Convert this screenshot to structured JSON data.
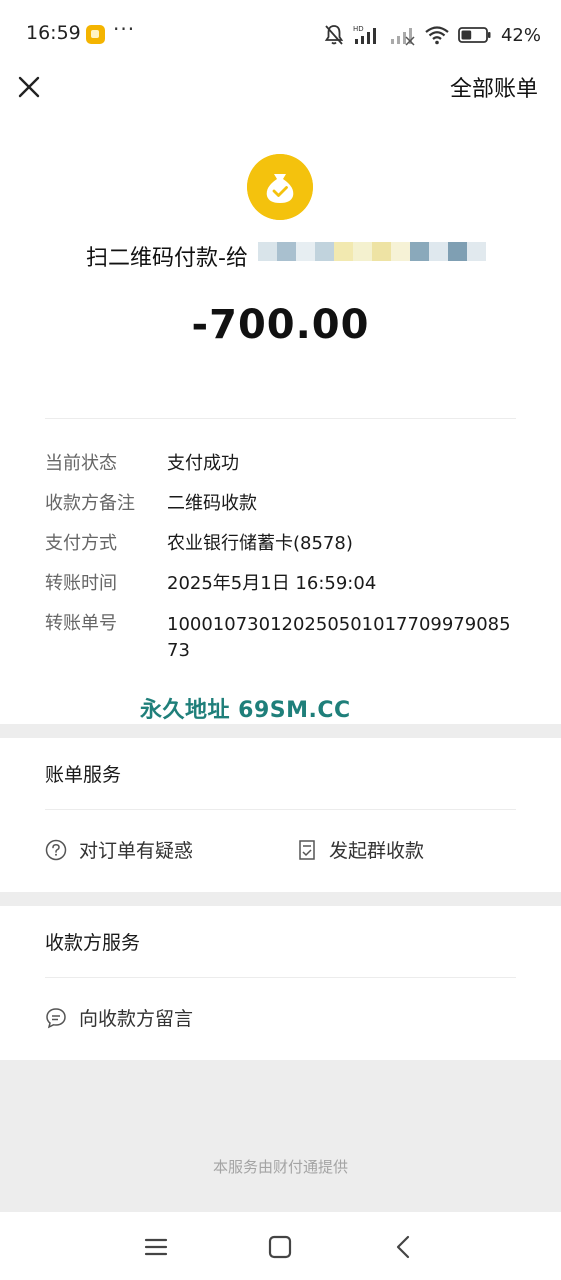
{
  "status_bar": {
    "time": "16:59",
    "app_icon": "notification-app-icon",
    "more": "···",
    "icons": [
      "bell-off-icon",
      "hd-signal-icon",
      "signal-icon",
      "wifi-icon",
      "battery-icon"
    ],
    "battery_text": "42%",
    "battery_level": 0.42
  },
  "header": {
    "close_icon": "close-icon",
    "all_bills_label": "全部账单"
  },
  "summary": {
    "icon": "money-bag-check-icon",
    "title": "扫二维码付款-给",
    "amount": "-700.00",
    "accent_color": "#f4c20d"
  },
  "details": [
    {
      "label": "当前状态",
      "value": "支付成功"
    },
    {
      "label": "收款方备注",
      "value": "二维码收款"
    },
    {
      "label": "支付方式",
      "value": "农业银行储蓄卡(8578)"
    },
    {
      "label": "转账时间",
      "value": "2025年5月1日 16:59:04"
    },
    {
      "label": "转账单号",
      "value": "100010730120250501017709979085 73"
    }
  ],
  "watermark": "永久地址 69SM.CC",
  "bill_service": {
    "title": "账单服务",
    "items": [
      {
        "label": "对订单有疑惑",
        "icon": "question-circle-icon"
      },
      {
        "label": "发起群收款",
        "icon": "group-collect-icon"
      }
    ]
  },
  "payee_service": {
    "title": "收款方服务",
    "items": [
      {
        "label": "向收款方留言",
        "icon": "chat-bubble-icon"
      }
    ]
  },
  "footer": {
    "note": "本服务由财付通提供"
  },
  "nav_bar": {
    "items": [
      "menu-icon",
      "home-square-icon",
      "back-chevron-icon"
    ]
  }
}
